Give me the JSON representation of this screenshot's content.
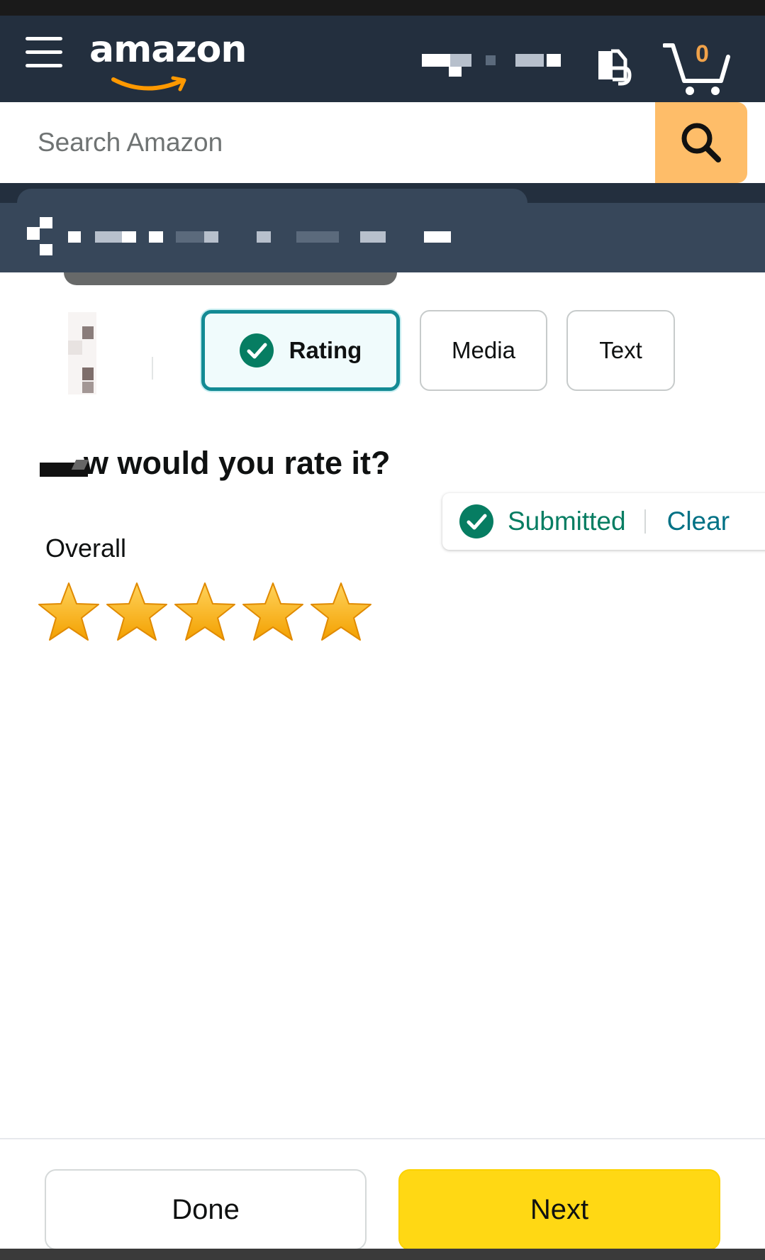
{
  "header": {
    "logo_text": "amazon",
    "cart_count": "0"
  },
  "search": {
    "placeholder": "Search Amazon"
  },
  "tabs": [
    {
      "label": "Rating",
      "active": true,
      "completed": true
    },
    {
      "label": "Media",
      "active": false
    },
    {
      "label": "Text",
      "active": false
    }
  ],
  "rating": {
    "question": "w would you rate it?",
    "status": "Submitted",
    "clear_label": "Clear",
    "overall_label": "Overall",
    "stars_selected": 5,
    "stars_total": 5
  },
  "footer": {
    "done_label": "Done",
    "next_label": "Next"
  },
  "colors": {
    "header_bg": "#232f3e",
    "subheader_bg": "#37475a",
    "search_button": "#febd69",
    "tab_active_border": "#138a94",
    "check_green": "#067d62",
    "link_teal": "#007185",
    "star_gold": "#ffb400",
    "next_button": "#ffd814"
  },
  "icons": {
    "menu": "hamburger-menu-icon",
    "search": "magnifier-icon",
    "cart": "shopping-cart-icon",
    "returns": "returns-orders-icon",
    "check": "check-circle-icon",
    "star": "star-filled-icon"
  }
}
